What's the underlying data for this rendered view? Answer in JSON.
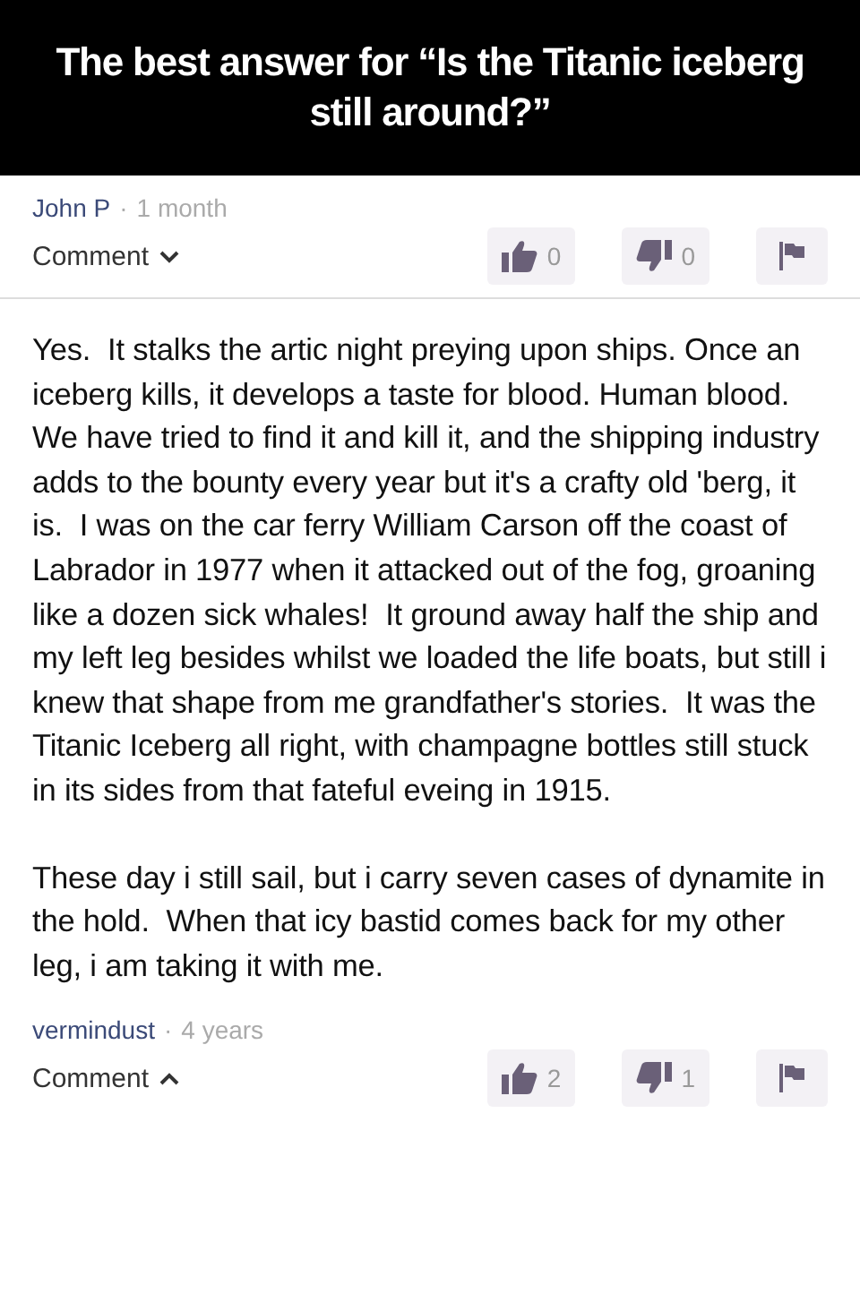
{
  "caption": "The best answer for “Is the Titanic iceberg still around?”",
  "question_meta": {
    "author": "John P",
    "separator": "·",
    "age": "1 month"
  },
  "question_actions": {
    "comment_label": "Comment",
    "expanded": false,
    "upvotes": "0",
    "downvotes": "0"
  },
  "answer": {
    "paragraphs": [
      "Yes.  It stalks the artic night preying upon ships. Once an iceberg kills, it develops a taste for blood. Human blood.  We have tried to find it and kill it, and the shipping industry adds to the bounty every year but it's a crafty old 'berg, it is.  I was on the car ferry William Carson off the coast of Labrador in 1977 when it attacked out of the fog, groaning like a dozen sick whales!  It ground away half the ship and my left leg besides whilst we loaded the life boats, but still i knew that shape from me grandfather's stories.  It was the Titanic Iceberg all right, with champagne bottles still stuck in its sides from that fateful eveing in 1915.",
      "These day i still sail, but i carry seven cases of dynamite in the hold.  When that icy bastid comes back for my other leg, i am taking it with me."
    ]
  },
  "answer_meta": {
    "author": "vermindust",
    "separator": "·",
    "age": "4 years"
  },
  "answer_actions": {
    "comment_label": "Comment",
    "expanded": true,
    "upvotes": "2",
    "downvotes": "1"
  }
}
